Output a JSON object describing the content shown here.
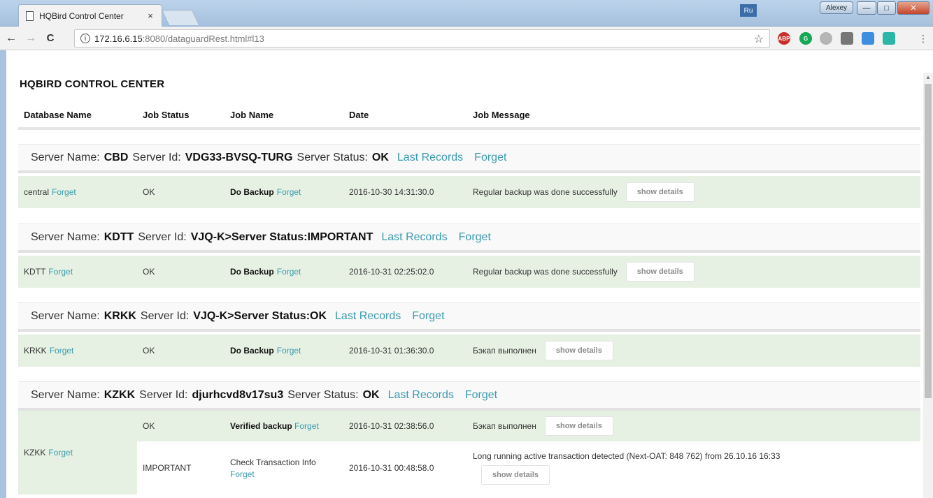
{
  "browser": {
    "tab_title": "HQBird Control Center",
    "tab_close": "×",
    "lang": "Ru",
    "user": "Alexey",
    "url_host": "172.16.6.15",
    "url_path": ":8080/dataguardRest.html#l13",
    "back": "←",
    "forward": "→",
    "reload": "C",
    "star": "☆",
    "menu": "⋮"
  },
  "app_title": "HQBIRD CONTROL CENTER",
  "columns": {
    "db": "Database Name",
    "status": "Job Status",
    "name": "Job Name",
    "date": "Date",
    "message": "Job Message"
  },
  "labels": {
    "server_name": "Server Name:",
    "server_id": "Server Id:",
    "server_status": "Server Status:",
    "last_records": "Last Records",
    "forget": "Forget",
    "show_details": "show details"
  },
  "servers": [
    {
      "name": "CBD",
      "id": "VDG33-BVSQ-TURG",
      "status": "OK",
      "db": "central",
      "job_status": "OK",
      "job_name": "Do Backup",
      "date": "2016-10-30 14:31:30.0",
      "message": "Regular backup was done successfully"
    },
    {
      "name": "KDTT",
      "id_status_text": "VJQ-K>Server Status:IMPORTANT",
      "db": "KDTT",
      "job_status": "OK",
      "job_name": "Do Backup",
      "date": "2016-10-31 02:25:02.0",
      "message": "Regular backup was done successfully"
    },
    {
      "name": "KRKK",
      "id_status_text": "VJQ-K>Server Status:OK",
      "db": "KRKK",
      "job_status": "OK",
      "job_name": "Do Backup",
      "date": "2016-10-31 01:36:30.0",
      "message": "Бэкап выполнен"
    },
    {
      "name": "KZKK",
      "id": "djurhcvd8v17su3",
      "status": "OK",
      "db": "KZKK",
      "jobs": [
        {
          "job_status": "OK",
          "job_name": "Verified backup",
          "date": "2016-10-31 02:38:56.0",
          "message": "Бэкап выполнен"
        },
        {
          "job_status": "IMPORTANT",
          "job_name": "Check Transaction Info",
          "date": "2016-10-31 00:48:58.0",
          "message": "Long running active transaction detected (Next-OAT: 848 762) from 26.10.16 16:33"
        }
      ]
    }
  ],
  "colors": {
    "link": "#3b9bb0",
    "ok_row_bg": "#e6f1e3",
    "server_row_bg": "#f9f9f9"
  }
}
